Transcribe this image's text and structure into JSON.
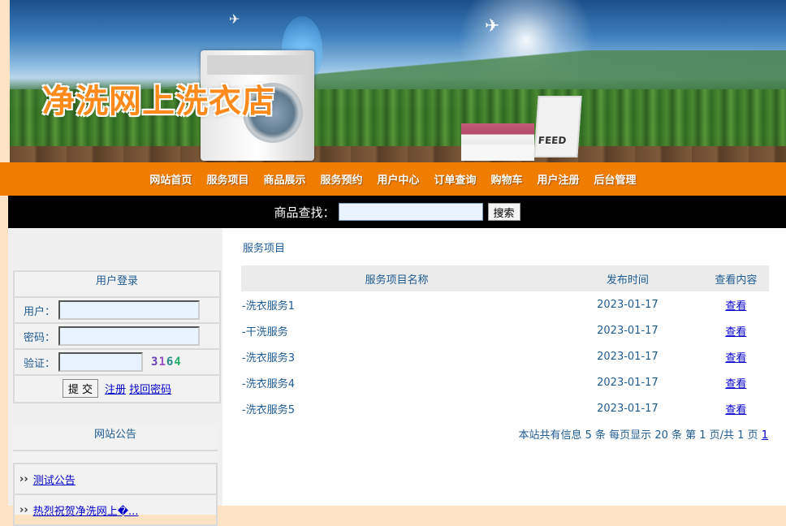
{
  "header": {
    "site_title": "净洗网上洗衣店",
    "basket_text": "FEED"
  },
  "nav": {
    "items": [
      "网站首页",
      "服务项目",
      "商品展示",
      "服务预约",
      "用户中心",
      "订单查询",
      "购物车",
      "用户注册",
      "后台管理"
    ]
  },
  "search": {
    "label": "商品查找：",
    "value": "",
    "button": "搜索"
  },
  "login": {
    "title": "用户登录",
    "user_label": "用户：",
    "pass_label": "密码：",
    "code_label": "验证：",
    "captcha": [
      "3",
      "1",
      "6",
      "4"
    ],
    "submit": "提 交",
    "register": "注册",
    "forgot": "找回密码"
  },
  "notice": {
    "title": "网站公告",
    "items": [
      "测试公告",
      "热烈祝贺净洗网上�..."
    ]
  },
  "main": {
    "breadcrumb": "服务项目",
    "columns": [
      "服务项目名称",
      "发布时间",
      "查看内容"
    ],
    "rows": [
      {
        "name": "-洗衣服务1",
        "date": "2023-01-17",
        "action": "查看"
      },
      {
        "name": "-干洗服务",
        "date": "2023-01-17",
        "action": "查看"
      },
      {
        "name": "-洗衣服务3",
        "date": "2023-01-17",
        "action": "查看"
      },
      {
        "name": "-洗衣服务4",
        "date": "2023-01-17",
        "action": "查看"
      },
      {
        "name": "-洗衣服务5",
        "date": "2023-01-17",
        "action": "查看"
      }
    ],
    "pager_text": "本站共有信息  5 条 每页显示 20 条 第 1 页/共 1 页",
    "pager_link": "1"
  },
  "colors": {
    "nav_bg": "#f07c00",
    "title_orange": "#ff8a1c",
    "link_blue": "#0000cc",
    "text_blue": "#1d5b93"
  }
}
